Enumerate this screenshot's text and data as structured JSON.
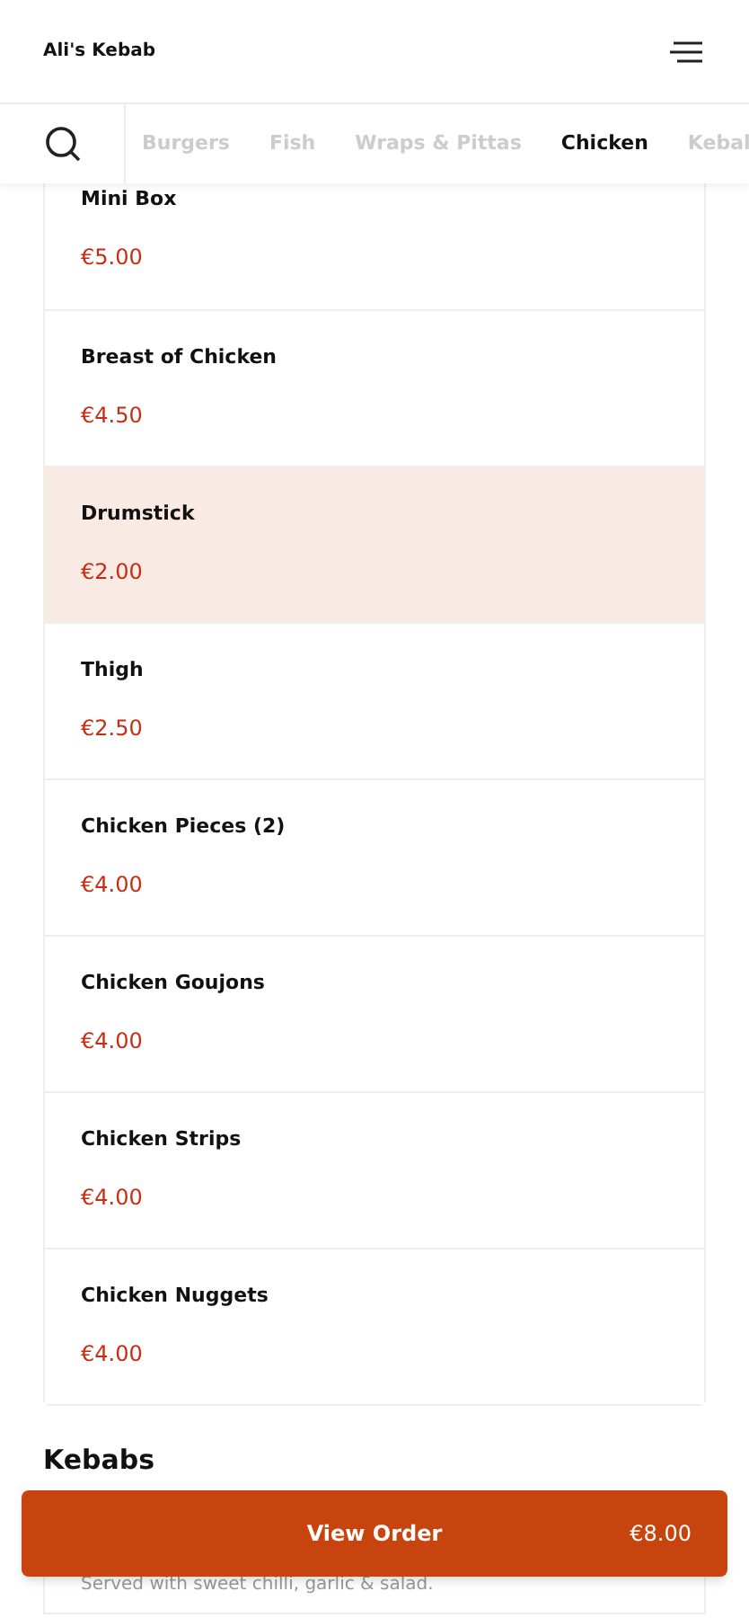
{
  "header": {
    "title": "Ali's Kebab"
  },
  "tabs": [
    {
      "label": "Burgers",
      "selected": false
    },
    {
      "label": "Fish",
      "selected": false
    },
    {
      "label": "Wraps & Pittas",
      "selected": false
    },
    {
      "label": "Chicken",
      "selected": true
    },
    {
      "label": "Kebal",
      "selected": false
    }
  ],
  "items": [
    {
      "name": "Mini Box",
      "price": "€5.00",
      "selected": false
    },
    {
      "name": "Breast of Chicken",
      "price": "€4.50",
      "selected": false
    },
    {
      "name": "Drumstick",
      "price": "€2.00",
      "selected": true
    },
    {
      "name": "Thigh",
      "price": "€2.50",
      "selected": false
    },
    {
      "name": "Chicken Pieces (2)",
      "price": "€4.00",
      "selected": false
    },
    {
      "name": "Chicken Goujons",
      "price": "€4.00",
      "selected": false
    },
    {
      "name": "Chicken Strips",
      "price": "€4.00",
      "selected": false
    },
    {
      "name": "Chicken Nuggets",
      "price": "€4.00",
      "selected": false
    }
  ],
  "next_section": {
    "title": "Kebabs",
    "description": "Served with sweet chilli, garlic & salad."
  },
  "order_button": {
    "label": "View Order",
    "total": "€8.00"
  }
}
